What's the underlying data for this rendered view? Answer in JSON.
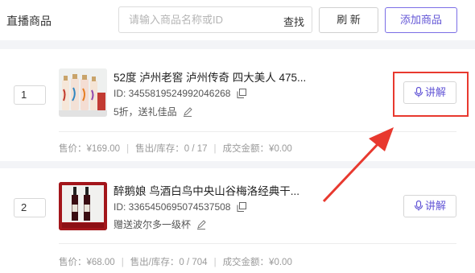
{
  "header": {
    "title": "直播商品",
    "search_placeholder": "请输入商品名称或ID",
    "search_label": "查找",
    "refresh_label": "刷 新",
    "add_label": "添加商品"
  },
  "products": [
    {
      "index": "1",
      "title": "52度 泸州老窖 泸州传奇 四大美人 475...",
      "id_text": "ID: 3455819524992046268",
      "tag": "5折，送礼佳品",
      "explain_label": "讲解",
      "price": "售价：¥169.00",
      "stock": "售出/库存：0 / 17",
      "gmv": "成交金额：¥0.00"
    },
    {
      "index": "2",
      "title": "醉鹅娘 鸟酒白鸟中央山谷梅洛经典干...",
      "id_text": "ID: 3365450695074537508",
      "tag": "赠送波尔多一级杯",
      "explain_label": "讲解",
      "price": "售价：¥68.00",
      "stock": "售出/库存：0 / 704",
      "gmv": "成交金额：¥0.00"
    }
  ],
  "colors": {
    "accent": "#6356d6",
    "annotation": "#e8392f",
    "page_bg": "#f3f4f7"
  },
  "icons": [
    "copy-icon",
    "edit-icon",
    "microphone-icon",
    "annotation-arrow"
  ]
}
